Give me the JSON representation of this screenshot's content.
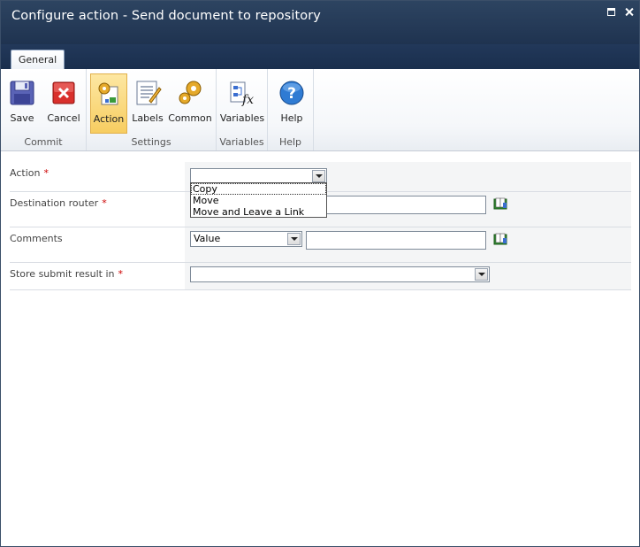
{
  "window": {
    "title": "Configure action - Send document to repository"
  },
  "tabs": [
    {
      "label": "General"
    }
  ],
  "ribbon": {
    "groups": [
      {
        "label": "Commit"
      },
      {
        "label": "Settings"
      },
      {
        "label": "Variables"
      },
      {
        "label": "Help"
      }
    ],
    "buttons": {
      "save": "Save",
      "cancel": "Cancel",
      "action": "Action",
      "labels": "Labels",
      "common": "Common",
      "variables": "Variables",
      "help": "Help"
    }
  },
  "form": {
    "action": {
      "label": "Action",
      "required": "*",
      "value": ""
    },
    "destination_router": {
      "label": "Destination router",
      "required": "*",
      "value": ""
    },
    "comments": {
      "label": "Comments",
      "mode": "Value",
      "value": ""
    },
    "store_result": {
      "label": "Store submit result in",
      "required": "*",
      "value": ""
    }
  },
  "action_dropdown": {
    "options": [
      "Copy",
      "Move",
      "Move and Leave a Link"
    ],
    "hovered": "Copy"
  },
  "colors": {
    "titlebar": "#2d4461",
    "selected_button": "#f7cd61",
    "required": "#cc0000"
  }
}
